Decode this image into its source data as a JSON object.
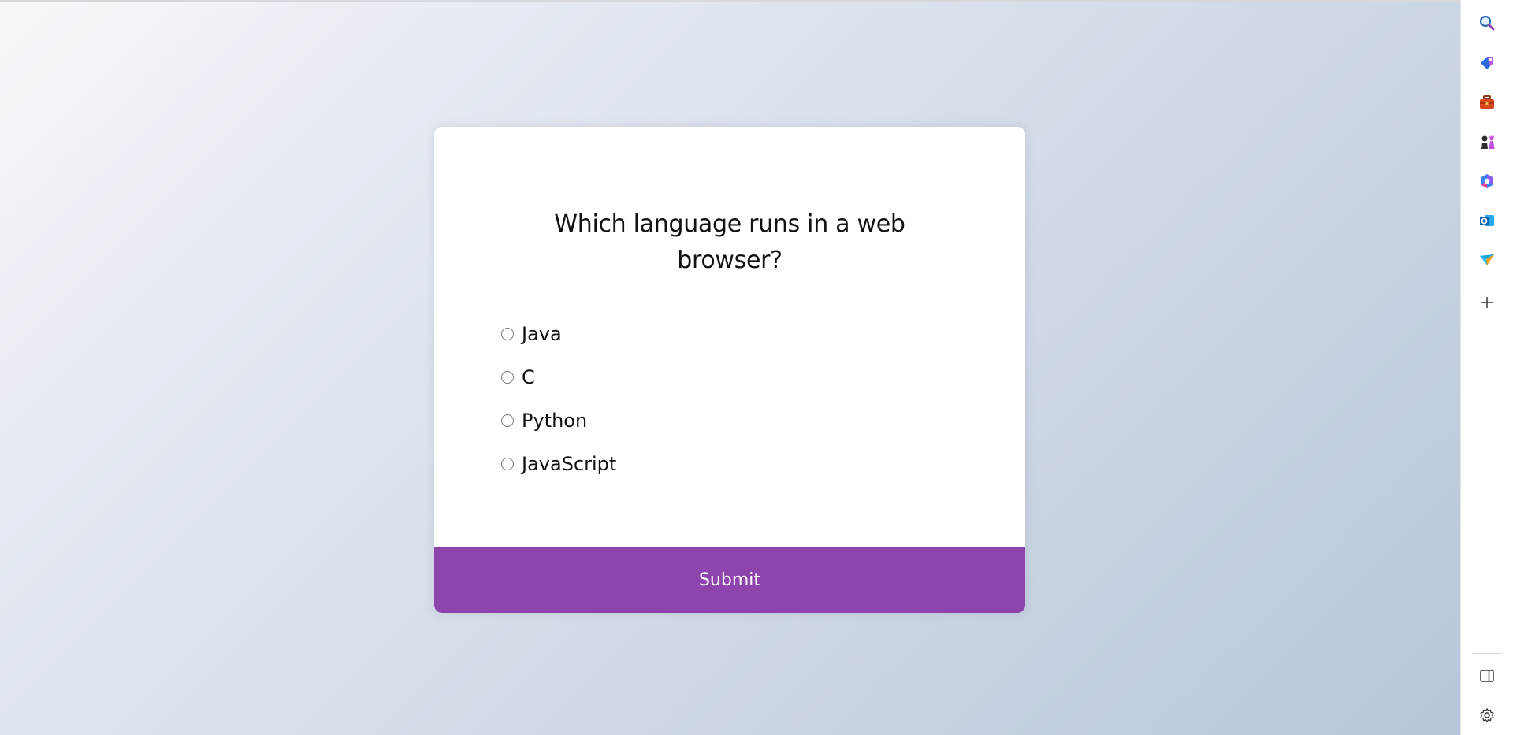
{
  "quiz": {
    "question": "Which language runs in a web browser?",
    "answers": [
      {
        "id": "a",
        "label": "Java"
      },
      {
        "id": "b",
        "label": "C"
      },
      {
        "id": "c",
        "label": "Python"
      },
      {
        "id": "d",
        "label": "JavaScript"
      }
    ],
    "submit_label": "Submit"
  },
  "colors": {
    "accent": "#8e44ad",
    "card": "#ffffff",
    "background_start": "#f5f7fa",
    "background_end": "#b7c6db"
  },
  "sidebar": {
    "icons": [
      "search-icon",
      "tag-icon",
      "toolbox-icon",
      "chess-icon",
      "copilot-icon",
      "outlook-icon",
      "send-icon",
      "add-icon"
    ],
    "bottom_icons": [
      "split-screen-icon",
      "settings-icon"
    ]
  }
}
